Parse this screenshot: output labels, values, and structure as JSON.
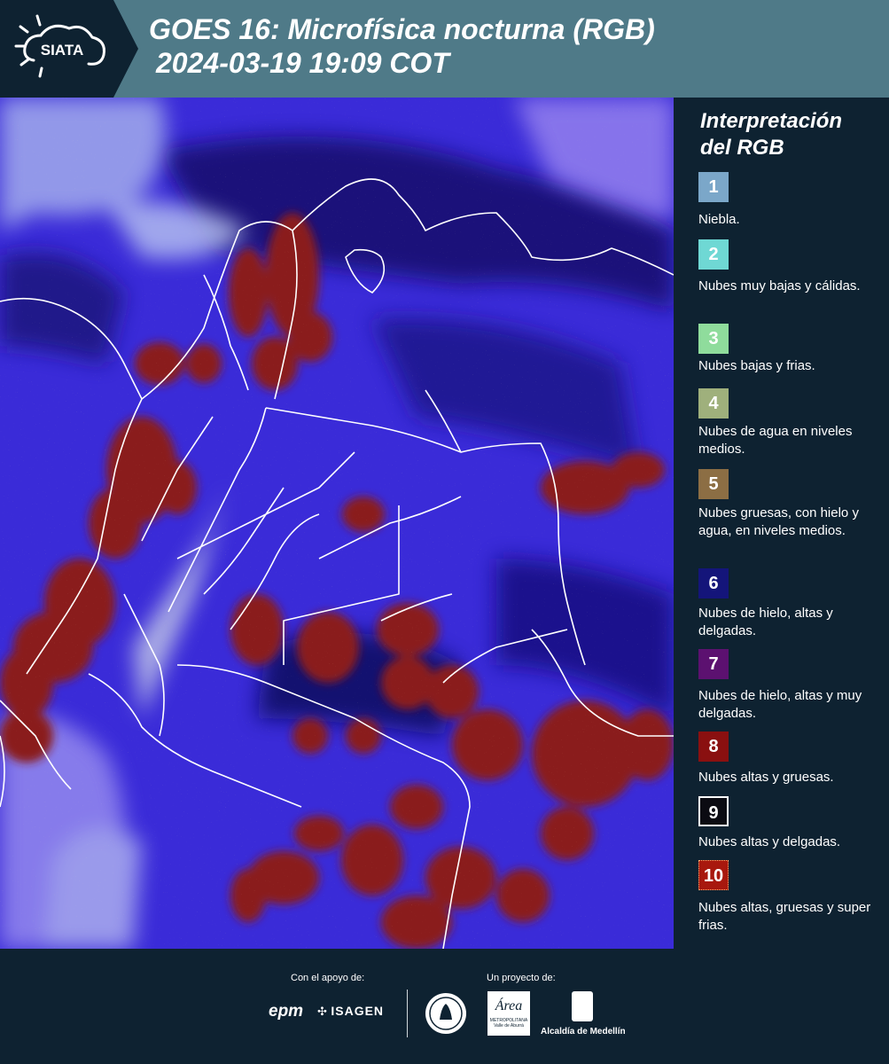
{
  "header": {
    "logo_text": "SIATA",
    "title_line1": "GOES 16: Microfísica nocturna (RGB)",
    "title_line2": "2024-03-19 19:09 COT"
  },
  "legend": {
    "title": "Interpretación del RGB",
    "items": [
      {
        "number": "1",
        "color": "#7ba7c9",
        "label": "Niebla."
      },
      {
        "number": "2",
        "color": "#6fd8d4",
        "label": "Nubes muy bajas y cálidas."
      },
      {
        "number": "3",
        "color": "#8fdc9c",
        "label": "Nubes bajas y frias."
      },
      {
        "number": "4",
        "color": "#9fb07c",
        "label": "Nubes de agua en niveles medios."
      },
      {
        "number": "5",
        "color": "#8c6e44",
        "label": "Nubes gruesas, con hielo y agua, en niveles medios."
      },
      {
        "number": "6",
        "color": "#14157a",
        "label": "Nubes de hielo, altas y delgadas."
      },
      {
        "number": "7",
        "color": "#5c1170",
        "label": "Nubes de hielo, altas y muy delgadas."
      },
      {
        "number": "8",
        "color": "#8a1010",
        "label": "Nubes altas y gruesas."
      },
      {
        "number": "9",
        "color": "#0b0b12",
        "label": "Nubes altas y delgadas."
      },
      {
        "number": "10",
        "color": "#a8180e",
        "label": "Nubes altas, gruesas y super frias."
      }
    ]
  },
  "footer": {
    "support_label": "Con el apoyo de:",
    "project_label": "Un proyecto de:",
    "sponsor1": "epm",
    "sponsor2": "ISAGEN",
    "partner_area": "Área",
    "partner_area_sub": "METROPOLITANA Valle de Aburrá",
    "partner_alcaldia": "Alcaldía de Medellín"
  }
}
